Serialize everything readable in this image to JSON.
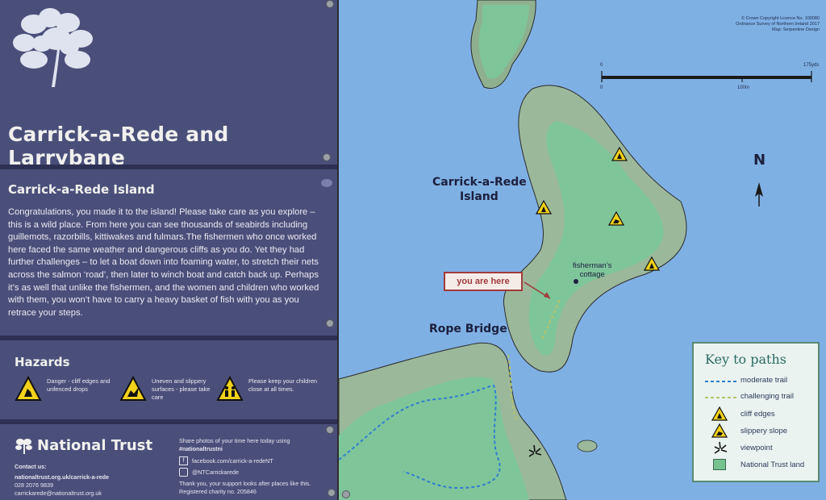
{
  "sign": {
    "title": "Carrick-a-Rede and Larrybane",
    "island_heading": "Carrick-a-Rede Island",
    "island_text": "Congratulations, you made it to the island! Please take care as you explore – this is a wild place. From here you can see thousands of seabirds including guillemots, razorbills, kittiwakes and fulmars.The fishermen who once worked here faced the same weather and dangerous cliffs as you do. Yet they had further challenges – to let a boat down into foaming water, to stretch their nets across the salmon ‘road’, then later to winch boat and catch back up. Perhaps it’s as well that unlike the fishermen, and the women and children who worked with them, you won’t have to carry a heavy basket of fish with you as you retrace your steps.",
    "hazards_heading": "Hazards",
    "hazards": [
      {
        "icon": "cliff-edge-warning-icon",
        "text": "Danger - cliff edges and unfenced drops"
      },
      {
        "icon": "slippery-surface-warning-icon",
        "text": "Uneven and slippery surfaces - please take care"
      },
      {
        "icon": "children-warning-icon",
        "text": "Please keep your children close at all times."
      }
    ],
    "brand": "National Trust",
    "contact_label": "Contact us:",
    "contact_url": "nationaltrust.org.uk/carrick-a-rede",
    "contact_phone": "028 2076 9839",
    "contact_email": "carrickarede@nationaltrust.org.uk",
    "share_text": "Share photos of your time here today using",
    "share_tag": "#nationaltrustni",
    "facebook": "facebook.com/carrick-a-redeNT",
    "instagram": "@NTCarrickarede",
    "thanks": "Thank you, your support looks after places like this.",
    "charity": "Registered charity no. 205846"
  },
  "map": {
    "credit_line1": "© Crown Copyright Licence No. 100080",
    "credit_line2": "Ordnance Survey of Northern Ireland 2017",
    "credit_line3": "Map: Serpentine Design",
    "scale_start": "0",
    "scale_end": "175yds",
    "scale_start_m": "0",
    "scale_mid_m": "100m",
    "north": "N",
    "island_label_1": "Carrick-a-Rede",
    "island_label_2": "Island",
    "bridge_label": "Rope Bridge",
    "cottage_label_1": "fisherman’s",
    "cottage_label_2": "cottage",
    "you_are_here": "you are here",
    "key_title": "Key to paths",
    "key": [
      {
        "label": "moderate trail",
        "color": "#2f7fd0"
      },
      {
        "label": "challenging trail",
        "color": "#b5c36a"
      },
      {
        "label": "cliff edges",
        "icon": "cliff-edge-icon"
      },
      {
        "label": "slippery slope",
        "icon": "slippery-slope-icon"
      },
      {
        "label": "viewpoint",
        "icon": "viewpoint-icon"
      },
      {
        "label": "National Trust land",
        "color": "#76c28e"
      }
    ]
  }
}
